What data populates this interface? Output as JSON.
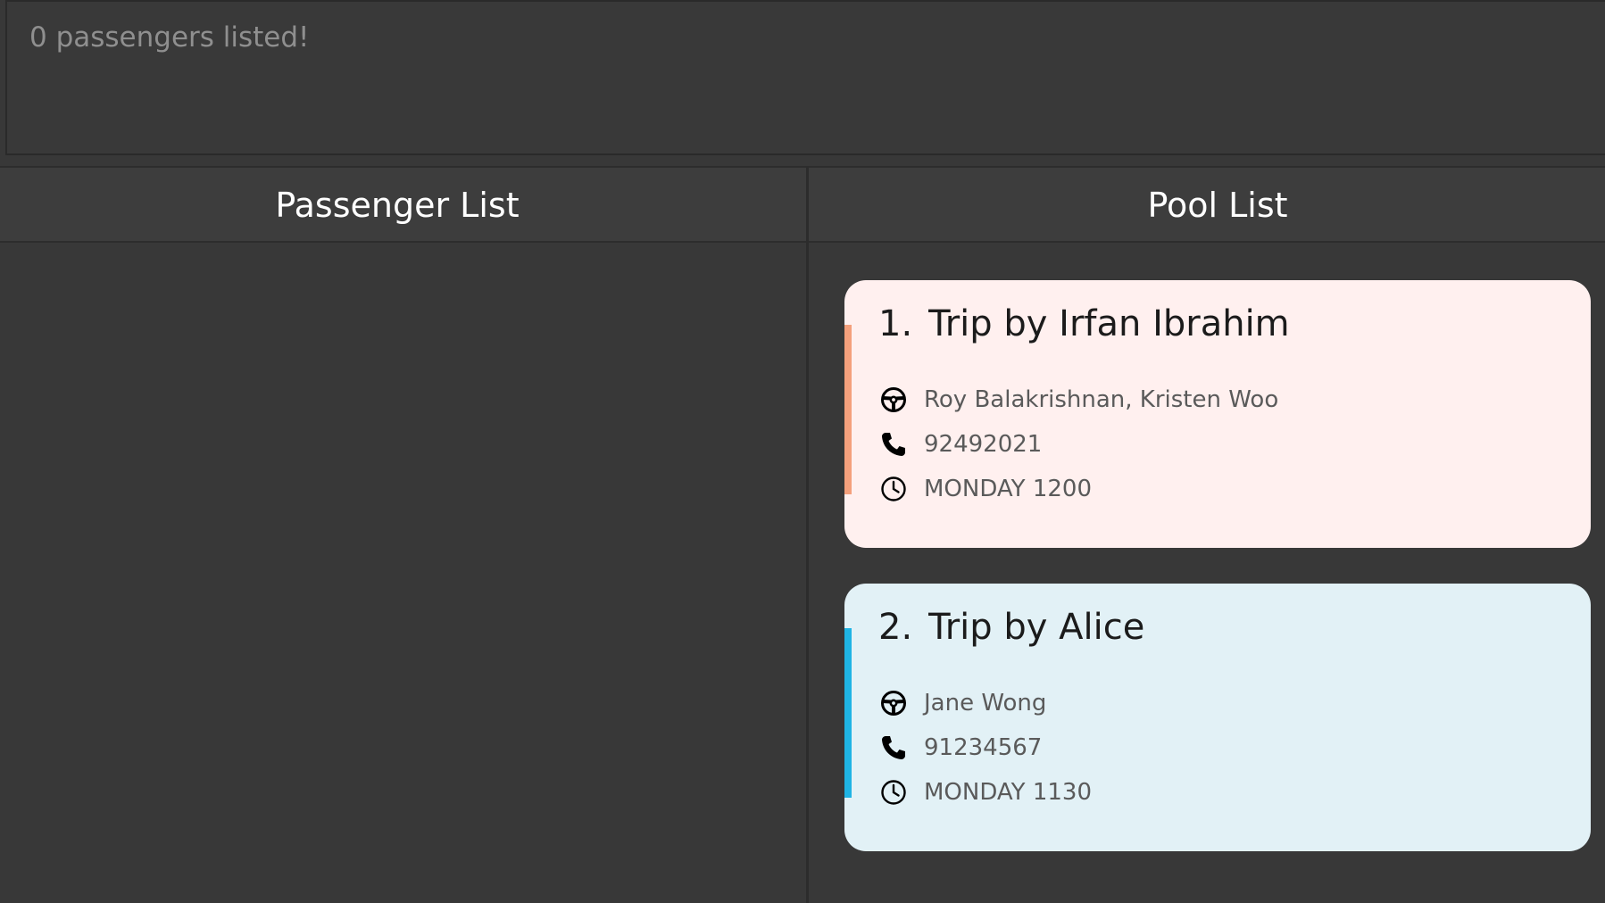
{
  "result": {
    "message": "0 passengers listed!"
  },
  "columns": {
    "passenger_title": "Passenger List",
    "pool_title": "Pool List"
  },
  "pools": [
    {
      "index": "1.",
      "title": "Trip by Irfan Ibrahim",
      "passengers": "Roy Balakrishnan, Kristen Woo",
      "phone": "92492021",
      "time": "MONDAY 1200",
      "bg_color": "#fff0ef",
      "accent_color": "#f4a07c"
    },
    {
      "index": "2.",
      "title": "Trip by Alice",
      "passengers": "Jane Wong",
      "phone": "91234567",
      "time": "MONDAY 1130",
      "bg_color": "#e2f1f6",
      "accent_color": "#1fb4e4"
    }
  ],
  "icons": {
    "passengers": "steering-wheel-icon",
    "phone": "phone-icon",
    "time": "clock-icon"
  }
}
